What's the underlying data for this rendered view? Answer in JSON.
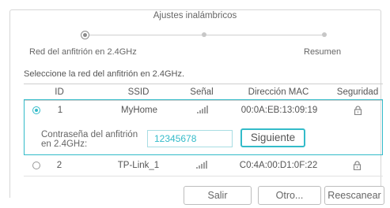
{
  "wizard": {
    "title": "Ajustes inalámbricos",
    "steps": [
      {
        "label": "Red del anfitrión en 2.4GHz",
        "state": "current"
      },
      {
        "label": "",
        "state": "pending"
      },
      {
        "label": "Resumen",
        "state": "pending"
      }
    ]
  },
  "select_prompt": "Seleccione la red del anfitrión en 2.4GHz.",
  "table": {
    "headers": {
      "id": "ID",
      "ssid": "SSID",
      "signal": "Señal",
      "mac": "Dirección MAC",
      "security": "Seguridad"
    },
    "rows": [
      {
        "id": "1",
        "ssid": "MyHome",
        "mac": "00:0A:EB:13:09:19",
        "selected": true,
        "signal_icon": "signal-bars-icon",
        "security_icon": "lock-icon"
      },
      {
        "id": "2",
        "ssid": "TP-Link_1",
        "mac": "C0:4A:00:D1:0F:22",
        "selected": false,
        "signal_icon": "signal-bars-icon",
        "security_icon": "lock-icon"
      }
    ]
  },
  "password": {
    "label": "Contraseña del anfitrión en 2.4GHz:",
    "value": "12345678"
  },
  "buttons": {
    "next": "Siguiente",
    "exit": "Salir",
    "other": "Otro...",
    "rescan": "Reescanear"
  },
  "colors": {
    "accent": "#33bbc9",
    "border": "#cfcfcf",
    "text": "#555555"
  }
}
